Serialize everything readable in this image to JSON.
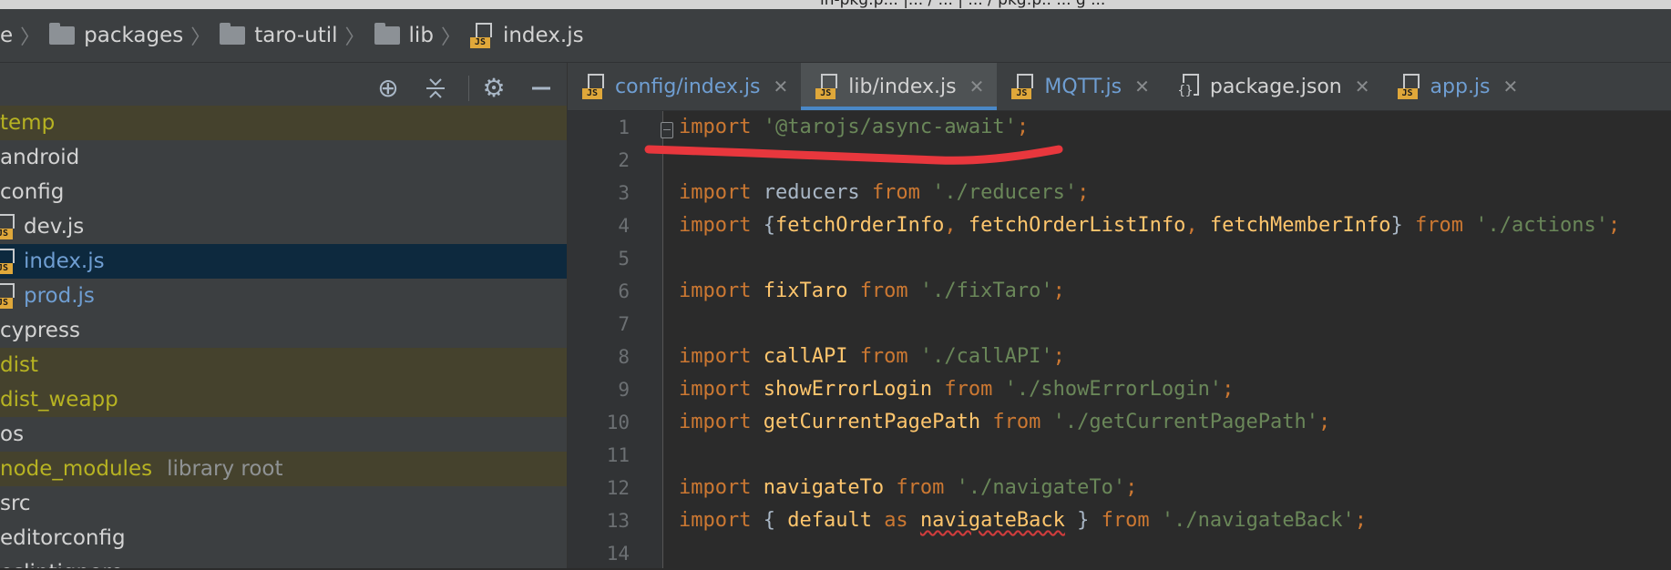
{
  "window": {
    "title_fragment": "in-pkg:p... |... / ...  | ... / pkg:p.. ... g ..."
  },
  "breadcrumb": {
    "items": [
      {
        "label": "e",
        "icon": "none"
      },
      {
        "label": "packages",
        "icon": "folder-icon"
      },
      {
        "label": "taro-util",
        "icon": "folder-icon"
      },
      {
        "label": "lib",
        "icon": "folder-icon"
      },
      {
        "label": "index.js",
        "icon": "js-file-icon"
      }
    ]
  },
  "sidebar": {
    "toolbar_icons": [
      "locate-icon",
      "collapse-all-icon",
      "gear-icon",
      "hide-icon"
    ],
    "tree": [
      {
        "label": "temp",
        "state": "excluded"
      },
      {
        "label": "android",
        "state": "normal"
      },
      {
        "label": "config",
        "state": "normal"
      },
      {
        "label": "dev.js",
        "state": "file"
      },
      {
        "label": "index.js",
        "state": "file-selected"
      },
      {
        "label": "prod.js",
        "state": "file-blue"
      },
      {
        "label": "cypress",
        "state": "normal"
      },
      {
        "label": "dist",
        "state": "excluded"
      },
      {
        "label": "dist_weapp",
        "state": "excluded"
      },
      {
        "label": "os",
        "state": "normal"
      },
      {
        "label": "node_modules",
        "extra": "library root",
        "state": "excluded"
      },
      {
        "label": "src",
        "state": "normal"
      },
      {
        "label": "editorconfig",
        "state": "normal"
      },
      {
        "label": "eslintignore",
        "state": "normal"
      }
    ]
  },
  "tabs": [
    {
      "label": "config/index.js",
      "icon": "js-file-icon",
      "active": false,
      "blue": true
    },
    {
      "label": "lib/index.js",
      "icon": "js-file-icon",
      "active": true,
      "blue": false
    },
    {
      "label": "MQTT.js",
      "icon": "js-file-icon",
      "active": false,
      "blue": true
    },
    {
      "label": "package.json",
      "icon": "json-file-icon",
      "active": false,
      "blue": false
    },
    {
      "label": "app.js",
      "icon": "js-file-icon",
      "active": false,
      "blue": true
    }
  ],
  "editor": {
    "line_numbers": [
      "1",
      "2",
      "3",
      "4",
      "5",
      "6",
      "7",
      "8",
      "9",
      "10",
      "11",
      "12",
      "13",
      "14"
    ],
    "lines": [
      [
        {
          "t": "kw",
          "v": "import "
        },
        {
          "t": "str",
          "v": "'@tarojs/async-await'"
        },
        {
          "t": "punc",
          "v": ";"
        }
      ],
      [],
      [
        {
          "t": "kw",
          "v": "import "
        },
        {
          "t": "plain",
          "v": "reducers "
        },
        {
          "t": "kw",
          "v": "from "
        },
        {
          "t": "str",
          "v": "'./reducers'"
        },
        {
          "t": "punc",
          "v": ";"
        }
      ],
      [
        {
          "t": "kw",
          "v": "import "
        },
        {
          "t": "plain",
          "v": "{"
        },
        {
          "t": "ident",
          "v": "fetchOrderInfo"
        },
        {
          "t": "punc",
          "v": ", "
        },
        {
          "t": "ident",
          "v": "fetchOrderListInfo"
        },
        {
          "t": "punc",
          "v": ", "
        },
        {
          "t": "ident",
          "v": "fetchMemberInfo"
        },
        {
          "t": "plain",
          "v": "} "
        },
        {
          "t": "kw",
          "v": "from "
        },
        {
          "t": "str",
          "v": "'./actions'"
        },
        {
          "t": "punc",
          "v": ";"
        }
      ],
      [],
      [
        {
          "t": "kw",
          "v": "import "
        },
        {
          "t": "ident",
          "v": "fixTaro "
        },
        {
          "t": "kw",
          "v": "from "
        },
        {
          "t": "str",
          "v": "'./fixTaro'"
        },
        {
          "t": "punc",
          "v": ";"
        }
      ],
      [],
      [
        {
          "t": "kw",
          "v": "import "
        },
        {
          "t": "ident",
          "v": "callAPI "
        },
        {
          "t": "kw",
          "v": "from "
        },
        {
          "t": "str",
          "v": "'./callAPI'"
        },
        {
          "t": "punc",
          "v": ";"
        }
      ],
      [
        {
          "t": "kw",
          "v": "import "
        },
        {
          "t": "ident",
          "v": "showErrorLogin "
        },
        {
          "t": "kw",
          "v": "from "
        },
        {
          "t": "str",
          "v": "'./showErrorLogin'"
        },
        {
          "t": "punc",
          "v": ";"
        }
      ],
      [
        {
          "t": "kw",
          "v": "import "
        },
        {
          "t": "ident",
          "v": "getCurrentPagePath "
        },
        {
          "t": "kw",
          "v": "from "
        },
        {
          "t": "str",
          "v": "'./getCurrentPagePath'"
        },
        {
          "t": "punc",
          "v": ";"
        }
      ],
      [],
      [
        {
          "t": "kw",
          "v": "import "
        },
        {
          "t": "ident",
          "v": "navigateTo "
        },
        {
          "t": "kw",
          "v": "from "
        },
        {
          "t": "str",
          "v": "'./navigateTo'"
        },
        {
          "t": "punc",
          "v": ";"
        }
      ],
      [
        {
          "t": "kw",
          "v": "import "
        },
        {
          "t": "plain",
          "v": "{ "
        },
        {
          "t": "ident",
          "v": "default "
        },
        {
          "t": "kw",
          "v": "as "
        },
        {
          "t": "squig",
          "v": "navigateBack"
        },
        {
          "t": "plain",
          "v": " } "
        },
        {
          "t": "kw",
          "v": "from "
        },
        {
          "t": "str",
          "v": "'./navigateBack'"
        },
        {
          "t": "punc",
          "v": ";"
        }
      ],
      []
    ]
  },
  "annotation": {
    "color": "#e8373d"
  }
}
